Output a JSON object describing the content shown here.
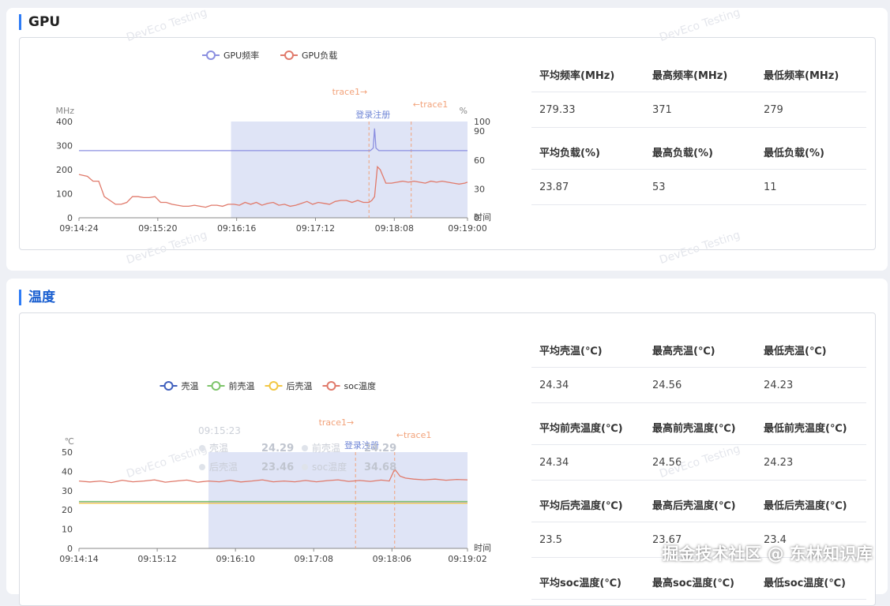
{
  "watermark": "DevEco Testing",
  "corner_watermark": "掘金技术社区 @ 东林知识库",
  "gpu": {
    "section_title": "GPU",
    "stats": [
      {
        "label": "平均频率(MHz)",
        "value": "279.33"
      },
      {
        "label": "最高频率(MHz)",
        "value": "371"
      },
      {
        "label": "最低频率(MHz)",
        "value": "279"
      },
      {
        "label": "平均负载(%)",
        "value": "23.87"
      },
      {
        "label": "最高负载(%)",
        "value": "53"
      },
      {
        "label": "最低负载(%)",
        "value": "11"
      }
    ]
  },
  "temp": {
    "section_title": "温度",
    "stats": [
      {
        "label": "平均壳温(℃)",
        "value": "24.34"
      },
      {
        "label": "最高壳温(℃)",
        "value": "24.56"
      },
      {
        "label": "最低壳温(℃)",
        "value": "24.23"
      },
      {
        "label": "平均前壳温度(℃)",
        "value": "24.34"
      },
      {
        "label": "最高前壳温度(℃)",
        "value": "24.56"
      },
      {
        "label": "最低前壳温度(℃)",
        "value": "24.23"
      },
      {
        "label": "平均后壳温度(℃)",
        "value": "23.5"
      },
      {
        "label": "最高后壳温度(℃)",
        "value": "23.67"
      },
      {
        "label": "最低后壳温度(℃)",
        "value": "23.4"
      },
      {
        "label": "平均soc温度(℃)",
        "value": ""
      },
      {
        "label": "最高soc温度(℃)",
        "value": ""
      },
      {
        "label": "最低soc温度(℃)",
        "value": ""
      }
    ]
  },
  "chart_data": [
    {
      "type": "line",
      "colors": {
        "GPU频率": "#8b8fe0",
        "GPU负载": "#e07a6b",
        "band": "#dfe4f6",
        "marker": "#f2a27a",
        "band_label": "#6f86d6"
      },
      "x_ticks": [
        "09:14:24",
        "09:15:20",
        "09:16:16",
        "09:17:12",
        "09:18:08",
        "09:19:00"
      ],
      "x_range": [
        0,
        276
      ],
      "xlabel": "时间",
      "y_left": {
        "label": "MHz",
        "ticks": [
          0,
          100,
          200,
          300,
          400
        ],
        "range": [
          0,
          400
        ]
      },
      "y_right": {
        "label": "%",
        "ticks": [
          0,
          30,
          60,
          90,
          100
        ],
        "range": [
          0,
          100
        ]
      },
      "region": {
        "label": "登录注册",
        "start": "09:16:12",
        "end": "09:19:00"
      },
      "markers": [
        {
          "label": "trace1→",
          "at": "09:17:50"
        },
        {
          "label": "←trace1",
          "at": "09:18:20"
        }
      ],
      "series": [
        {
          "name": "GPU频率",
          "axis": "left",
          "x": [
            0,
            207,
            209,
            210,
            211,
            213,
            276
          ],
          "y": [
            279,
            279,
            290,
            371,
            290,
            279,
            279
          ]
        },
        {
          "name": "GPU负载",
          "axis": "right",
          "x": [
            0,
            6,
            10,
            14,
            18,
            22,
            26,
            30,
            34,
            38,
            42,
            46,
            50,
            54,
            58,
            62,
            66,
            70,
            74,
            78,
            82,
            86,
            90,
            94,
            98,
            102,
            106,
            110,
            114,
            118,
            122,
            126,
            130,
            134,
            138,
            142,
            146,
            150,
            154,
            158,
            162,
            166,
            170,
            174,
            178,
            182,
            186,
            190,
            194,
            198,
            202,
            206,
            208,
            210,
            212,
            214,
            218,
            222,
            226,
            230,
            234,
            238,
            242,
            246,
            250,
            254,
            258,
            262,
            266,
            270,
            274,
            276
          ],
          "y": [
            45,
            43,
            38,
            38,
            22,
            18,
            14,
            14,
            16,
            22,
            22,
            21,
            21,
            22,
            16,
            16,
            14,
            13,
            12,
            12,
            13,
            12,
            11,
            13,
            13,
            12,
            14,
            14,
            13,
            16,
            14,
            16,
            13,
            15,
            16,
            13,
            14,
            12,
            13,
            15,
            17,
            14,
            16,
            15,
            14,
            17,
            18,
            18,
            16,
            18,
            16,
            16,
            18,
            22,
            53,
            50,
            36,
            36,
            37,
            38,
            37,
            38,
            37,
            36,
            38,
            37,
            38,
            37,
            36,
            35,
            36,
            37
          ]
        }
      ]
    },
    {
      "type": "line",
      "colors": {
        "壳温": "#3f5fbd",
        "前壳温": "#7dc46a",
        "后壳温": "#f2c744",
        "soc温度": "#e07a6b",
        "band": "#dfe4f6",
        "marker": "#f2a27a",
        "band_label": "#6f86d6"
      },
      "x_ticks": [
        "09:14:14",
        "09:15:12",
        "09:16:10",
        "09:17:08",
        "09:18:06",
        "09:19:02"
      ],
      "x_range": [
        0,
        288
      ],
      "xlabel": "时间",
      "y_left": {
        "label": "℃",
        "ticks": [
          0,
          10,
          20,
          30,
          40,
          50
        ],
        "range": [
          0,
          50
        ]
      },
      "region": {
        "label": "登录注册",
        "start": "09:15:50",
        "end": "09:19:02"
      },
      "markers": [
        {
          "label": "trace1→",
          "at": "09:17:39"
        },
        {
          "label": "←trace1",
          "at": "09:18:08"
        }
      ],
      "tooltip": {
        "time": "09:15:23",
        "rows": [
          {
            "name": "壳温",
            "value": "24.29"
          },
          {
            "name": "前壳温",
            "value": "24.29"
          },
          {
            "name": "后壳温",
            "value": "23.46"
          },
          {
            "name": "soc温度",
            "value": "34.68"
          }
        ]
      },
      "series": [
        {
          "name": "壳温",
          "x": [
            0,
            288
          ],
          "y": [
            24.3,
            24.3
          ]
        },
        {
          "name": "前壳温",
          "x": [
            0,
            288
          ],
          "y": [
            24.4,
            24.4
          ]
        },
        {
          "name": "后壳温",
          "x": [
            0,
            288
          ],
          "y": [
            23.5,
            23.5
          ]
        },
        {
          "name": "soc温度",
          "x": [
            0,
            8,
            16,
            24,
            32,
            40,
            48,
            56,
            64,
            72,
            80,
            88,
            96,
            104,
            112,
            120,
            128,
            136,
            144,
            152,
            160,
            168,
            176,
            184,
            192,
            200,
            208,
            216,
            224,
            230,
            234,
            238,
            242,
            248,
            256,
            264,
            272,
            280,
            288
          ],
          "y": [
            35,
            34.5,
            35,
            34.2,
            35.4,
            34.6,
            35,
            35.6,
            34.4,
            35,
            35.5,
            34.4,
            35,
            34.6,
            35.4,
            34.5,
            35,
            35.6,
            34.6,
            35,
            34.6,
            35.3,
            34.6,
            35.2,
            35.6,
            34.8,
            35.3,
            34.8,
            35.5,
            35,
            41.2,
            37.5,
            36.5,
            36,
            35.6,
            36,
            35.4,
            35.8,
            35.6
          ]
        }
      ]
    }
  ]
}
